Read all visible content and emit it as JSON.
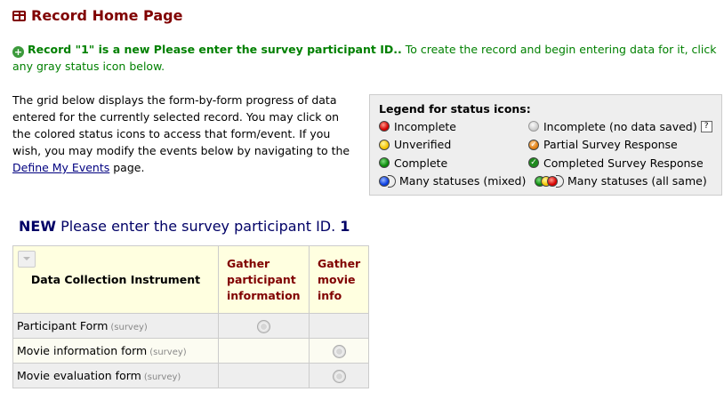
{
  "page": {
    "title": "Record Home Page",
    "notice_bold": "Record \"1\" is a new Please enter the survey participant ID..",
    "notice_text": " To create the record and begin entering data for it, click any gray status icon below."
  },
  "intro": {
    "text": "The grid below displays the form-by-form progress of data entered for the currently selected record. You may click on the colored status icons to access that form/event. If you wish, you may modify the events below by navigating to the ",
    "link": "Define My Events",
    "after": " page."
  },
  "legend": {
    "title": "Legend for status icons:",
    "items": {
      "incomplete": "Incomplete",
      "incomplete_nodata": "Incomplete (no data saved)",
      "help": "?",
      "unverified": "Unverified",
      "partial": "Partial Survey Response",
      "complete": "Complete",
      "completed_survey": "Completed Survey Response",
      "mixed": "Many statuses (mixed)",
      "same": "Many statuses (all same)"
    }
  },
  "record": {
    "new_label": "NEW",
    "id_label": "Please enter the survey participant ID.",
    "id_value": "1"
  },
  "grid": {
    "instrument_header": "Data Collection Instrument",
    "events": [
      "Gather participant information",
      "Gather movie info"
    ],
    "survey_tag": "(survey)",
    "rows": [
      {
        "form": "Participant Form",
        "e1": true,
        "e2": false
      },
      {
        "form": "Movie information form",
        "e1": false,
        "e2": true
      },
      {
        "form": "Movie evaluation form",
        "e1": false,
        "e2": true
      }
    ]
  }
}
